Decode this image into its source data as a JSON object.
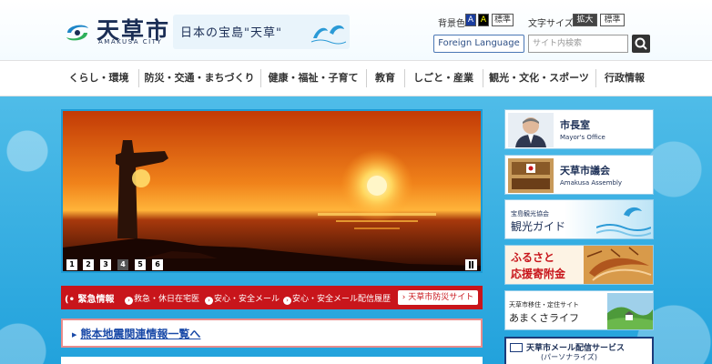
{
  "header": {
    "logo_title": "天草市",
    "logo_sub": "AMAKUSA CITY",
    "slogan": "日本の宝島\"天草\"",
    "bg_color_label": "背景色",
    "bg_swatch_1": "A",
    "bg_swatch_2": "A",
    "bg_standard": "標準",
    "font_size_label": "文字サイズ",
    "font_enlarge": "拡大",
    "font_standard": "標準",
    "foreign_language": "Foreign Language",
    "search_placeholder": "サイト内検索",
    "colors": {
      "brand_navy": "#1b2e55",
      "accent_blue": "#1c9bd6",
      "emergency_red": "#c8151b"
    }
  },
  "nav": {
    "items": [
      {
        "label": "くらし・環境"
      },
      {
        "label": "防災・交通・まちづくり"
      },
      {
        "label": "健康・福祉・子育て"
      },
      {
        "label": "教育"
      },
      {
        "label": "しごと・産業"
      },
      {
        "label": "観光・文化・スポーツ"
      },
      {
        "label": "行政情報"
      }
    ]
  },
  "slideshow": {
    "slides": [
      "1",
      "2",
      "3",
      "4",
      "5",
      "6"
    ],
    "active": "4"
  },
  "emergency": {
    "title": "緊急情報",
    "links": [
      "救急・休日在宅医",
      "安心・安全メール",
      "安心・安全メール配信履歴"
    ],
    "button": "天草市防災サイト"
  },
  "quake": {
    "link": "熊本地震関連情報一覧へ"
  },
  "banners": {
    "mayor_title": "市長室",
    "mayor_sub": "Mayor's Office",
    "assembly_title": "天草市議会",
    "assembly_sub": "Amakusa Assembly",
    "guide_small": "宝島観光協会",
    "guide_big": "観光ガイド",
    "furusato_line1": "ふるさと",
    "furusato_line2": "応援寄附金",
    "life_small": "天草市移住・定住サイト",
    "life_big": "あまくさライフ",
    "mail_title": "天草市メール配信サービス",
    "mail_sub": "(パーソナライズ)"
  }
}
